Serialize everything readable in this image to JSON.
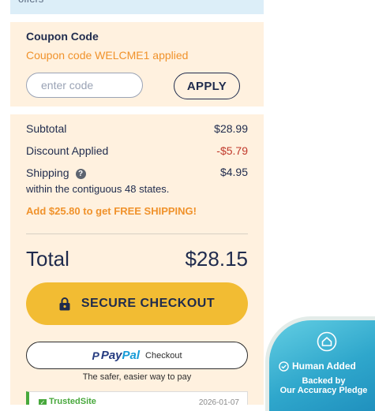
{
  "offers": {
    "text": "offers"
  },
  "coupon": {
    "title": "Coupon Code",
    "applied_message": "Coupon code WELCME1 applied",
    "input_placeholder": "enter code",
    "apply_label": "APPLY"
  },
  "summary": {
    "subtotal_label": "Subtotal",
    "subtotal_value": "$28.99",
    "discount_label": "Discount Applied",
    "discount_value": "-$5.79",
    "shipping_label": "Shipping",
    "shipping_help_icon": "?",
    "shipping_value": "$4.95",
    "shipping_note": "within the contiguous 48 states.",
    "free_shipping_message": "Add $25.80 to get FREE SHIPPING!",
    "total_label": "Total",
    "total_value": "$28.15"
  },
  "checkout": {
    "button_label": "SECURE CHECKOUT",
    "icon": "lock-icon"
  },
  "paypal": {
    "mark": "P",
    "word1": "Pay",
    "word2": "Pal",
    "checkout_label": "Checkout",
    "tagline": "The safer, easier way to pay"
  },
  "trustedsite": {
    "logo_text": "TrustedSite",
    "date": "2026-01-07"
  },
  "pledge_badge": {
    "icon": "house-icon",
    "title": "Human Added",
    "subtitle_line1": "Backed by",
    "subtitle_line2": "Our Accuracy Pledge"
  },
  "colors": {
    "navy": "#1f2b4d",
    "orange": "#f0922b",
    "discount_red": "#c0392b",
    "checkout_yellow": "#f2bc33",
    "coupon_bg": "#fff1df",
    "offers_bg": "#dceef8",
    "paypal_dark": "#253b80",
    "paypal_light": "#179bd7",
    "trusted_green": "#48a83c",
    "pledge_blue": "#2fa7cc"
  }
}
